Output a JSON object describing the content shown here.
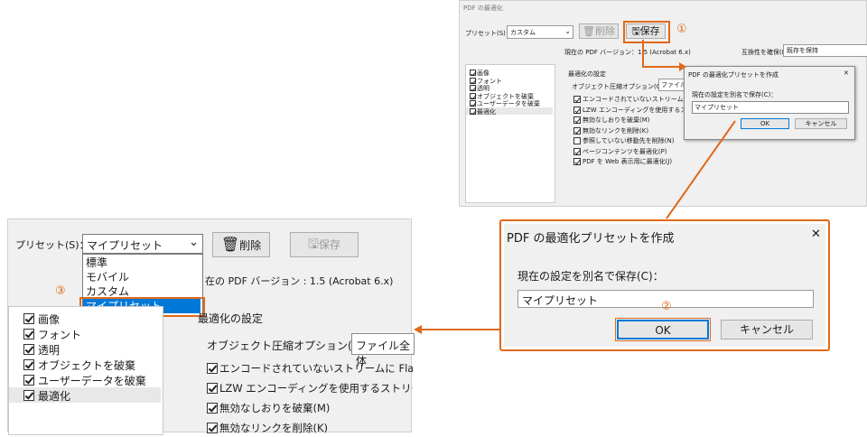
{
  "big": {
    "preset_label": "プリセット(S)：",
    "preset_value": "マイプリセット",
    "dropdown_options": [
      "標準",
      "モバイル",
      "カスタム",
      "マイプリセット"
    ],
    "delete_label": "削除",
    "save_label": "保存",
    "version_text": "在の PDF バージョン : 1.5 (Acrobat 6.x)",
    "section_title": "最適化の設定",
    "compression_label": "オブジェクト圧縮オプション(O)：",
    "compression_value": "ファイル全体",
    "sidebar": [
      "画像",
      "フォント",
      "透明",
      "オブジェクトを破棄",
      "ユーザーデータを破棄",
      "最適化"
    ],
    "options": [
      "エンコードされていないストリームに Flate 圧",
      "LZW エンコーディングを使用するストリーム",
      "無効なしおりを破棄(M)",
      "無効なリンクを削除(K)"
    ]
  },
  "small": {
    "title": "PDF の最適化",
    "preset_label": "プリセット(S)：",
    "preset_value": "カスタム",
    "delete_label": "削除",
    "save_label": "保存",
    "version_text": "現在の PDF バージョン：1.5 (Acrobat 6.x)",
    "compat_label": "互換性を確保(B)：",
    "compat_value": "既存を保持",
    "sidebar": [
      "画像",
      "フォント",
      "透明",
      "オブジェクトを破棄",
      "ユーザーデータを破棄",
      "最適化"
    ],
    "section_title": "最適化の設定",
    "compression_label": "オブジェクト圧縮オプション(O)：",
    "compression_value": "ファイル",
    "options": [
      {
        "label": "エンコードされていないストリームに Flate",
        "checked": true
      },
      {
        "label": "LZW エンコーディングを使用するストリー",
        "checked": true
      },
      {
        "label": "無効なしおりを破棄(M)",
        "checked": true
      },
      {
        "label": "無効なリンクを削除(K)",
        "checked": true
      },
      {
        "label": "参照していない移動先を削除(N)",
        "checked": false
      },
      {
        "label": "ページコンテンツを最適化(P)",
        "checked": true
      },
      {
        "label": "PDF を Web 表示用に最適化(J)",
        "checked": true
      }
    ],
    "dialog": {
      "title": "PDF の最適化プリセットを作成",
      "prompt": "現在の設定を別名で保存(C)：",
      "value": "マイプリセット",
      "ok": "OK",
      "cancel": "キャンセル"
    }
  },
  "dialog": {
    "title": "PDF の最適化プリセットを作成",
    "close": "✕",
    "prompt": "現在の設定を別名で保存(C)：",
    "value": "マイプリセット",
    "ok": "OK",
    "cancel": "キャンセル"
  },
  "markers": {
    "one": "①",
    "two": "②",
    "three": "③"
  },
  "colors": {
    "accent": "#e0691a",
    "highlight": "#0078d7"
  },
  "icons": {
    "delete": "trash-icon",
    "save": "disk-icon",
    "dropdown": "chevron-down-icon",
    "close": "close-icon"
  }
}
